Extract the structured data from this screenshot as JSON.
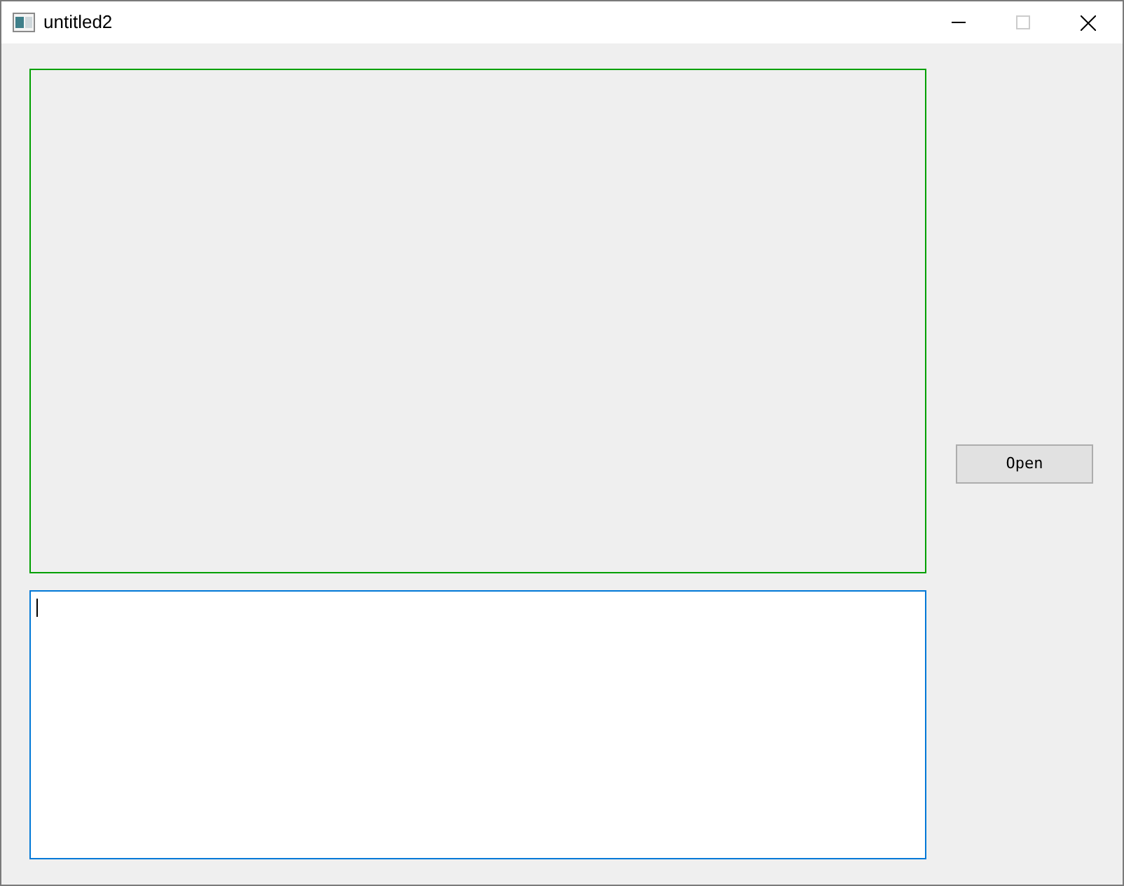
{
  "window": {
    "title": "untitled2",
    "maximize_disabled": true
  },
  "text_edit": {
    "focused": true
  },
  "buttons": [
    {
      "label": "Open"
    }
  ]
}
